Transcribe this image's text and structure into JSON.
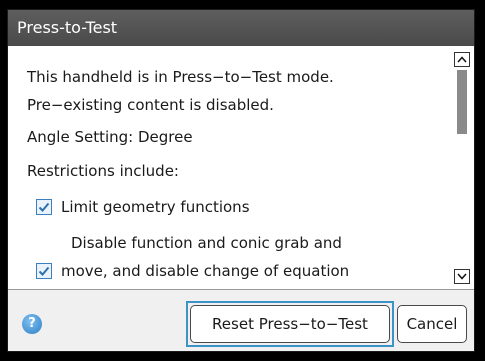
{
  "dialog": {
    "title": "Press-to-Test",
    "lines": [
      "This handheld is in Press−to−Test mode.",
      "Pre−existing content is disabled.",
      "Angle Setting: Degree",
      "Restrictions include:"
    ],
    "restrictions": [
      {
        "label": "Limit geometry functions",
        "checked": true
      },
      {
        "label_line1": "Disable function and conic grab and",
        "label_line2": "move, and disable change of equation",
        "checked": true
      }
    ],
    "buttons": {
      "reset": "Reset Press−to−Test",
      "cancel": "Cancel"
    },
    "help_icon_glyph": "?"
  },
  "colors": {
    "title_bar": "#555555",
    "checkbox_accent": "#3a7fc0",
    "focus_ring": "#3b93c8"
  }
}
